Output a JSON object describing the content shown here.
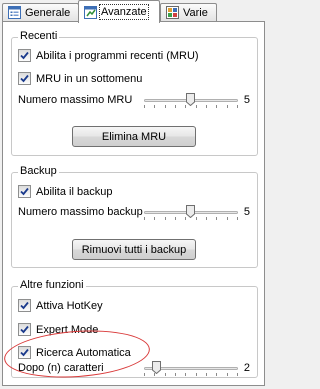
{
  "tabs": [
    {
      "label": "Generale",
      "icon": "window-list-icon"
    },
    {
      "label": "Avanzate",
      "icon": "settings-window-icon"
    },
    {
      "label": "Varie",
      "icon": "grid-apps-icon"
    }
  ],
  "active_tab": "Avanzate",
  "recenti": {
    "title": "Recenti",
    "enable_mru": {
      "label": "Abilita i programmi recenti (MRU)",
      "checked": true
    },
    "mru_submenu": {
      "label": "MRU in un sottomenu",
      "checked": true
    },
    "max_mru": {
      "label": "Numero massimo MRU",
      "value": "5",
      "position": 0.5
    },
    "clear_button": "Elimina MRU"
  },
  "backup": {
    "title": "Backup",
    "enable_backup": {
      "label": "Abilita il backup",
      "checked": true
    },
    "max_backup": {
      "label": "Numero massimo backup",
      "value": "5",
      "position": 0.5
    },
    "remove_button": "Rimuovi tutti i backup"
  },
  "altre": {
    "title": "Altre funzioni",
    "hotkey": {
      "label": "Attiva HotKey",
      "checked": true
    },
    "expert": {
      "label": "Expert Mode",
      "checked": true
    },
    "auto_search": {
      "label": "Ricerca Automatica",
      "checked": true
    },
    "after_chars": {
      "label": "Dopo (n) caratteri",
      "value": "2",
      "position": 0.1
    }
  },
  "colors": {
    "highlight_circle": "#d93a3a",
    "check": "#1a3a8c"
  }
}
